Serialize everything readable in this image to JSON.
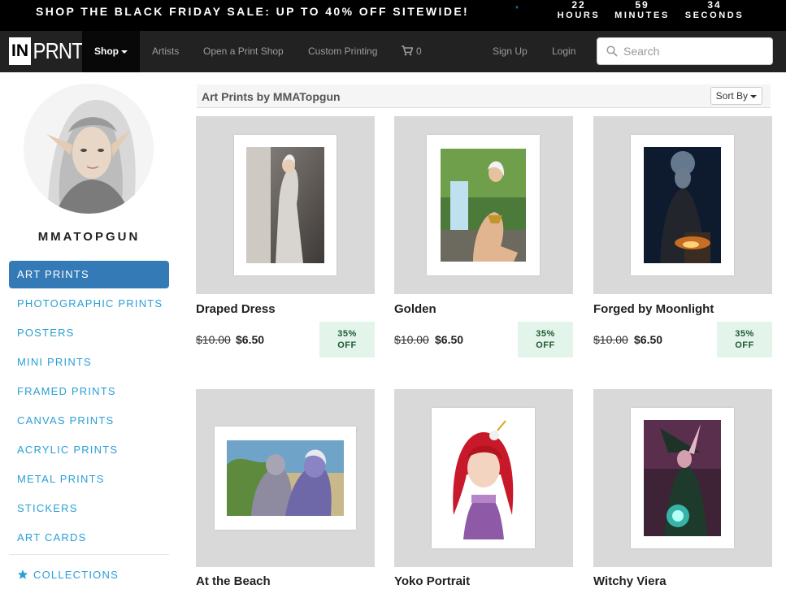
{
  "promo": {
    "text": "SHOP THE BLACK FRIDAY SALE: UP TO 40% OFF SITEWIDE!",
    "star": "*",
    "countdown": [
      {
        "num": "22",
        "unit": "HOURS"
      },
      {
        "num": "59",
        "unit": "MINUTES"
      },
      {
        "num": "34",
        "unit": "SECONDS"
      }
    ]
  },
  "nav": {
    "logo_in": "IN",
    "logo_prnt": "PRNT",
    "shop": "Shop",
    "artists": "Artists",
    "open_shop": "Open a Print Shop",
    "custom": "Custom Printing",
    "cart_count": "0",
    "signup": "Sign Up",
    "login": "Login",
    "search_placeholder": "Search"
  },
  "sidebar": {
    "artist_name": "MMATOPGUN",
    "items": [
      {
        "label": "ART PRINTS",
        "active": true
      },
      {
        "label": "PHOTOGRAPHIC PRINTS"
      },
      {
        "label": "POSTERS"
      },
      {
        "label": "MINI PRINTS"
      },
      {
        "label": "FRAMED PRINTS"
      },
      {
        "label": "CANVAS PRINTS"
      },
      {
        "label": "ACRYLIC PRINTS"
      },
      {
        "label": "METAL PRINTS"
      },
      {
        "label": "STICKERS"
      },
      {
        "label": "ART CARDS"
      }
    ],
    "collections": "COLLECTIONS"
  },
  "content": {
    "title": "Art Prints by MMATopgun",
    "sort_by": "Sort By"
  },
  "products": [
    {
      "title": "Draped Dress",
      "old_price": "$10.00",
      "new_price": "$6.50",
      "badge_pct": "35%",
      "badge_off": "OFF"
    },
    {
      "title": "Golden",
      "old_price": "$10.00",
      "new_price": "$6.50",
      "badge_pct": "35%",
      "badge_off": "OFF"
    },
    {
      "title": "Forged by Moonlight",
      "old_price": "$10.00",
      "new_price": "$6.50",
      "badge_pct": "35%",
      "badge_off": "OFF"
    },
    {
      "title": "At the Beach"
    },
    {
      "title": "Yoko Portrait"
    },
    {
      "title": "Witchy Viera"
    }
  ],
  "colors": {
    "accent": "#2a9fd6",
    "active": "#337ab7",
    "badge_bg": "#e3f5ea",
    "badge_text": "#1e5a33",
    "nav_bg": "#222222"
  }
}
